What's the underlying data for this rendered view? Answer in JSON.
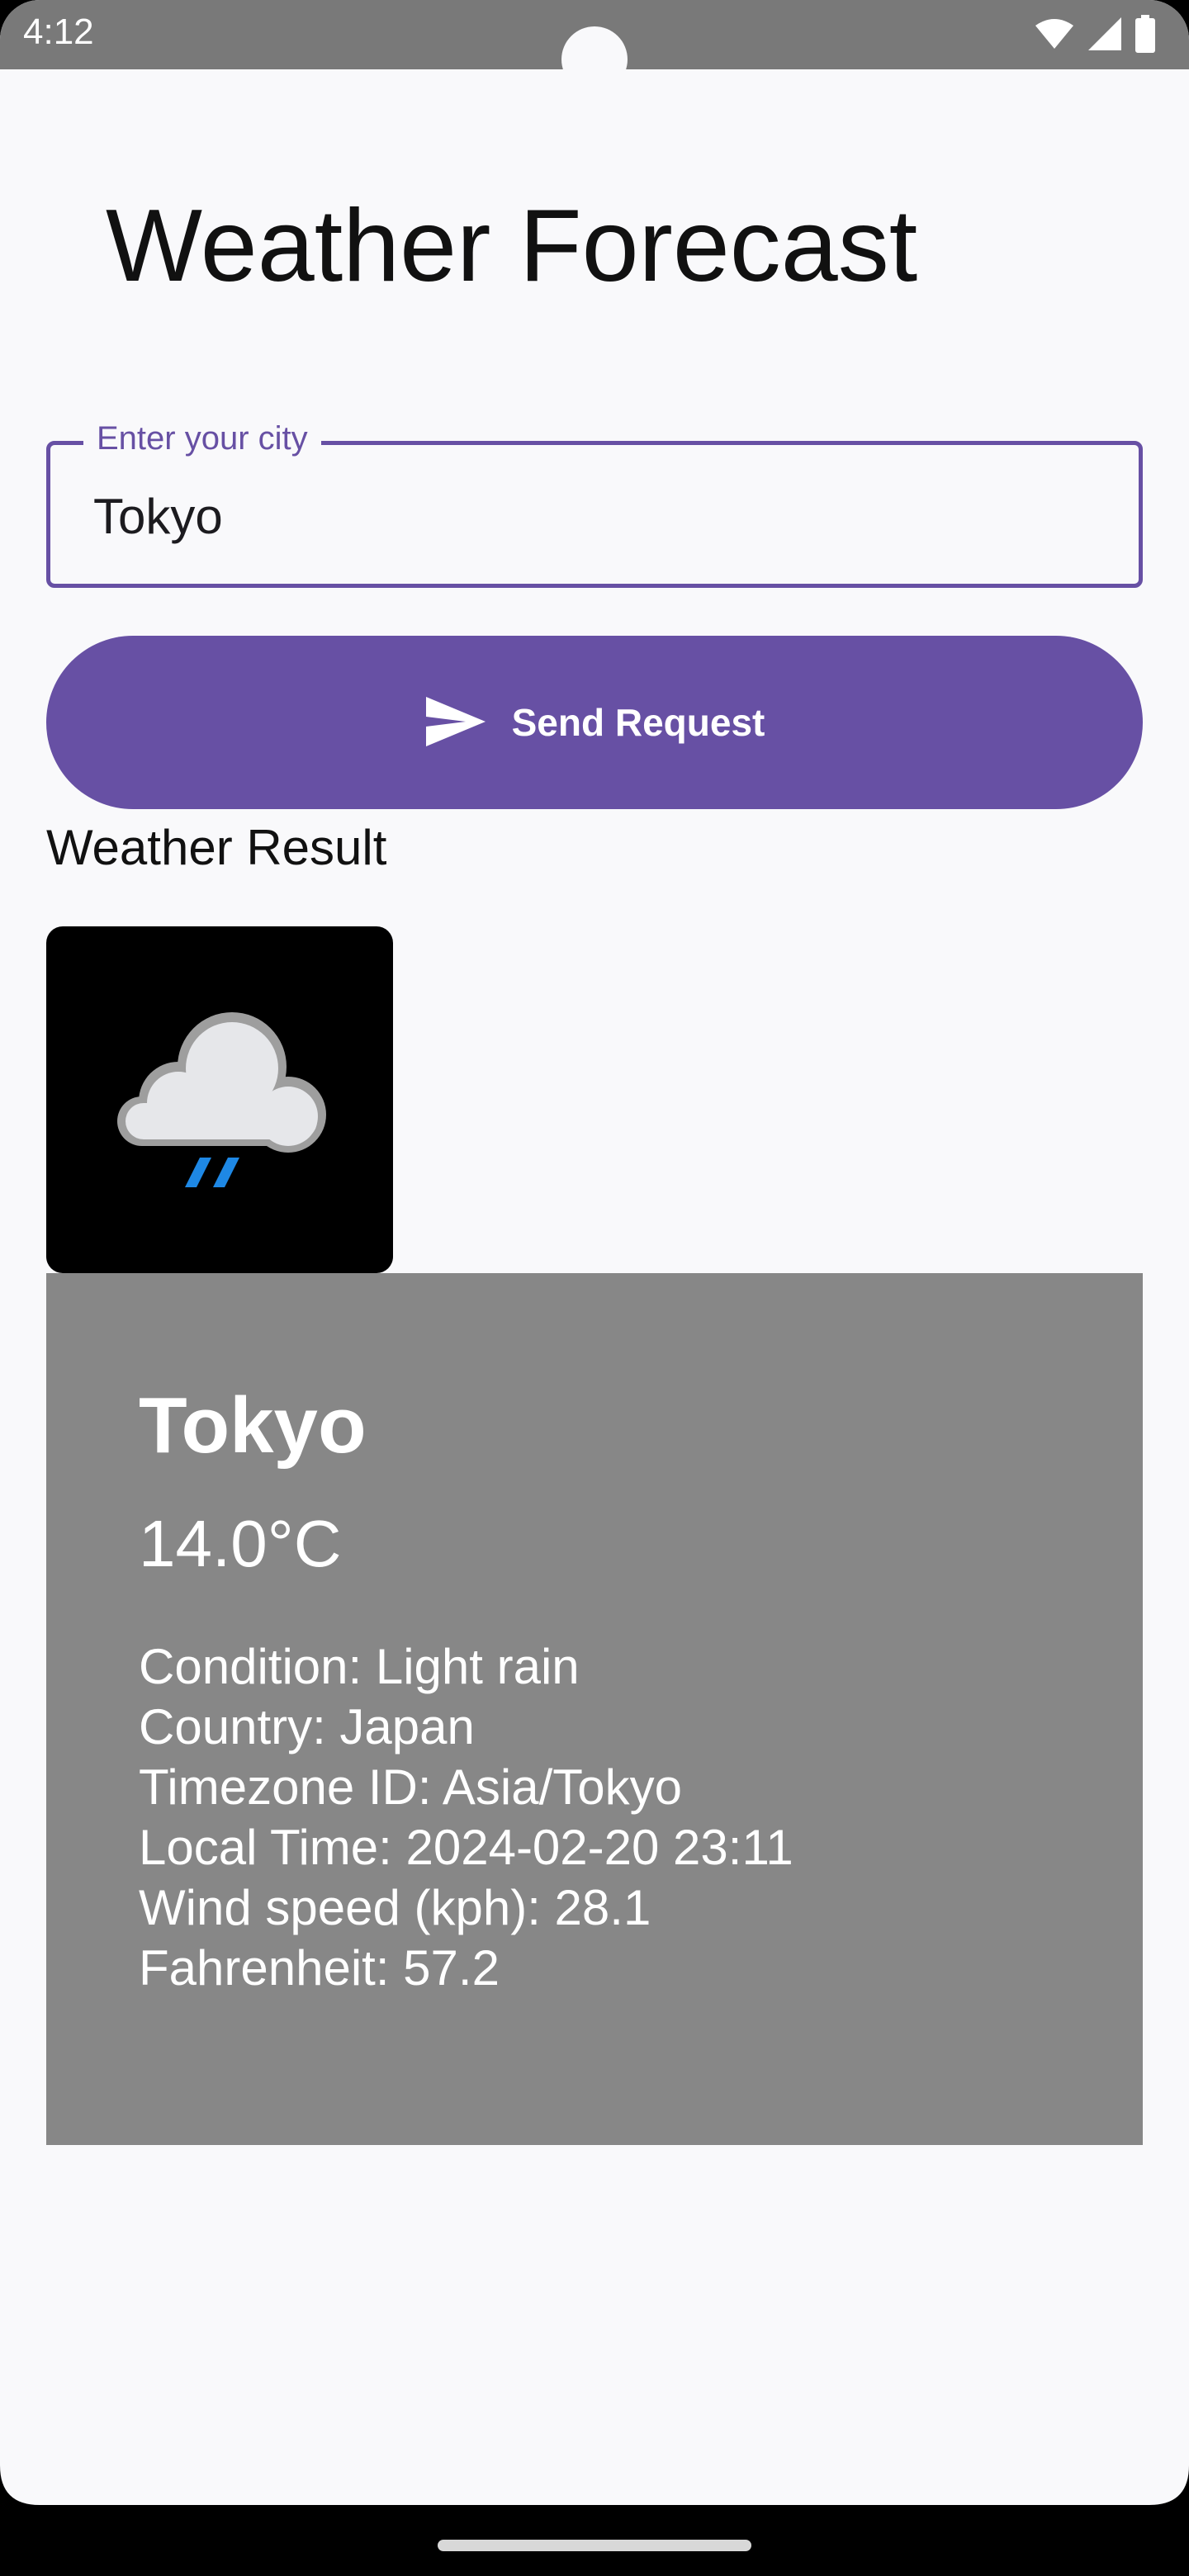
{
  "status_bar": {
    "time": "4:12",
    "icons": [
      "wifi-icon",
      "signal-icon",
      "battery-icon"
    ]
  },
  "app": {
    "title": "Weather Forecast"
  },
  "city_field": {
    "label": "Enter your city",
    "value": "Tokyo"
  },
  "send_button": {
    "label": "Send Request",
    "icon": "send-icon"
  },
  "result": {
    "heading": "Weather Result",
    "icon": "light-rain-icon",
    "city": "Tokyo",
    "temperature": "14.0°C",
    "details": [
      "Condition: Light rain",
      "Country: Japan",
      "Timezone ID: Asia/Tokyo",
      "Local Time: 2024-02-20 23:11",
      "Wind speed (kph): 28.1",
      "Fahrenheit: 57.2"
    ]
  },
  "colors": {
    "accent": "#6750a4",
    "status_bar": "#797979",
    "card": "#878787",
    "background": "#f9f9fb"
  }
}
